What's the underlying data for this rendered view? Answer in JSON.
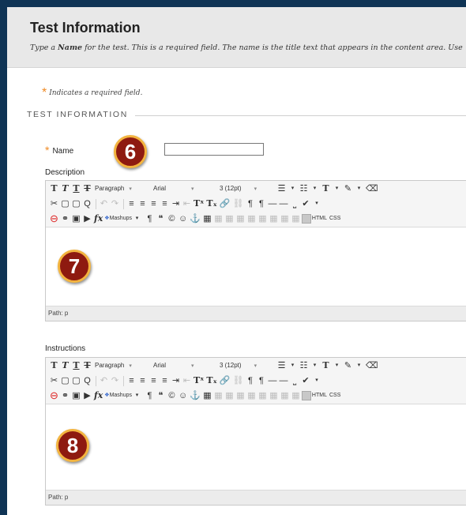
{
  "header": {
    "title": "Test Information",
    "intro_prefix": "Type a ",
    "intro_bold": "Name",
    "intro_suffix": " for the test. This is a required field. The name is the title text that appears in the content area. Use"
  },
  "required_note": {
    "star": "*",
    "text": "Indicates a required field."
  },
  "section": {
    "title": "TEST INFORMATION"
  },
  "name_field": {
    "star": "*",
    "label": "Name",
    "value": "",
    "badge": "6"
  },
  "description": {
    "label": "Description",
    "badge": "7",
    "path": "Path: p"
  },
  "instructions": {
    "label": "Instructions",
    "badge": "8",
    "path": "Path: p"
  },
  "toolbar": {
    "bold": "T",
    "italic": "T",
    "underline": "T",
    "strike": "T",
    "format": "Paragraph",
    "font": "Arial",
    "size": "3 (12pt)",
    "dropdown_arrow": "▾",
    "bullets": "☰",
    "numbers": "☷",
    "text_color": "T",
    "highlight": "✎",
    "eraser": "⌫",
    "cut": "✂",
    "copy": "▢",
    "paste": "▢",
    "find": "Q",
    "undo": "↶",
    "redo": "↷",
    "align_left": "≡",
    "align_center": "≡",
    "align_right": "≡",
    "justify": "≡",
    "indent": "⇥",
    "outdent": "⇤",
    "superscript": "Tˣ",
    "subscript": "Tₓ",
    "link": "🔗",
    "unlink": "⛓",
    "ltr": "¶",
    "rtl": "¶",
    "hr": "—",
    "hr2": "—",
    "nbsp": "⎵",
    "spellcheck": "✔",
    "record": "⊖",
    "attach": "⚭",
    "image": "▣",
    "media": "▶",
    "math": "fx",
    "mashups": "Mashups",
    "paragraph": "¶",
    "quote": "❝",
    "copyright": "©",
    "emoticon": "☺",
    "anchor": "⚓",
    "table": "▦",
    "html": "HTML",
    "css": "CSS"
  },
  "colors": {
    "frame": "#0f3455",
    "header_bg": "#e8e8e8",
    "required_star": "#f08a24",
    "badge_fill": "#8e1a10",
    "badge_ring": "#f3b43f"
  }
}
